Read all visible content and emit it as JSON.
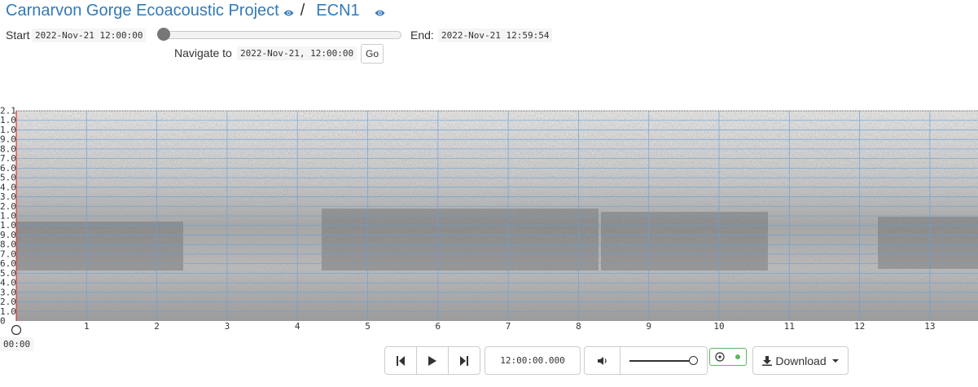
{
  "header": {
    "project": "Carnarvon Gorge Ecoacoustic Project",
    "separator": "/",
    "site": "ECN1",
    "icon": "eye-icon"
  },
  "range": {
    "start_label": "Start",
    "start_time": "2022-Nov-21 12:00:00",
    "end_label": "End:",
    "end_time": "2022-Nov-21 12:59:54",
    "position_fraction": 0
  },
  "navigate": {
    "label": "Navigate to",
    "value": "2022-Nov-21, 12:00:00",
    "go_label": "Go"
  },
  "spectrogram": {
    "freq_labels": [
      "0",
      "1.0",
      "2.0",
      "3.0",
      "4.0",
      "5.0",
      "6.0",
      "7.0",
      "8.0",
      "9.0",
      "1.0",
      "1.0",
      "2.0",
      "3.0",
      "4.0",
      "5.0",
      "6.0",
      "7.0",
      "8.0",
      "9.0",
      "1.0",
      "1.0",
      "2.1"
    ],
    "time_labels": [
      "1",
      "2",
      "3",
      "4",
      "5",
      "6",
      "7",
      "8",
      "9",
      "10",
      "11",
      "12",
      "13"
    ],
    "start_time_label": "00:00",
    "grid_color": "#6a9fd6",
    "cursor_color": "#e0302a"
  },
  "player": {
    "prev_icon": "skip-back-icon",
    "play_icon": "play-icon",
    "next_icon": "skip-forward-icon",
    "current_time": "12:00:00.000",
    "volume_icon": "volume-icon",
    "volume_level": 1.0,
    "follow_icon": "target-icon",
    "download_label": "Download",
    "download_icon": "download-icon"
  }
}
